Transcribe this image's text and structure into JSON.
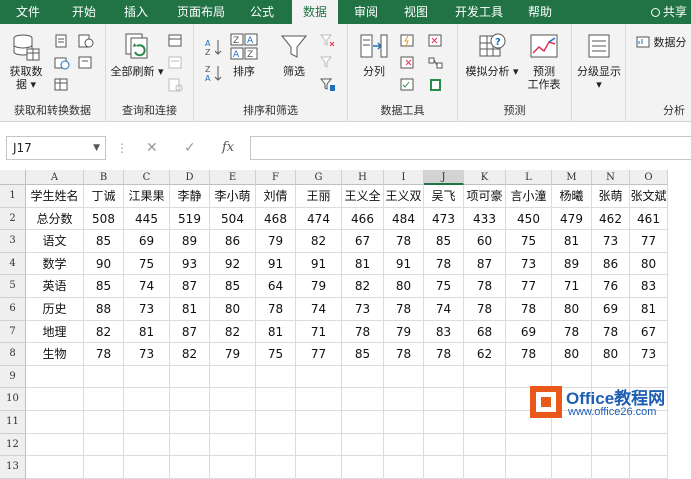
{
  "tabs": [
    "文件",
    "开始",
    "插入",
    "页面布局",
    "公式",
    "数据",
    "审阅",
    "视图",
    "开发工具",
    "帮助"
  ],
  "active_tab": "数据",
  "share_label": "共享",
  "ribbon": {
    "groups": [
      {
        "label": "获取和转换数据",
        "buttons": [
          "获取数据"
        ]
      },
      {
        "label": "查询和连接",
        "buttons": [
          "全部刷新"
        ]
      },
      {
        "label": "排序和筛选",
        "buttons": [
          "排序",
          "筛选"
        ]
      },
      {
        "label": "数据工具",
        "buttons": [
          "分列"
        ]
      },
      {
        "label": "预测",
        "buttons": [
          "模拟分析",
          "预测工作表"
        ]
      },
      {
        "label": "",
        "buttons": [
          "分级显示"
        ]
      },
      {
        "label": "分析",
        "buttons": [
          "数据分"
        ]
      }
    ],
    "get_data_line1": "获取数",
    "get_data_line2": "据",
    "refresh_all": "全部刷新",
    "sort": "排序",
    "filter": "筛选",
    "text_to_columns": "分列",
    "what_if": "模拟分析",
    "forecast_line1": "预测",
    "forecast_line2": "工作表",
    "outline": "分级显示",
    "data_analysis": "数据分"
  },
  "formula_bar": {
    "name_box": "J17",
    "fx": "fx",
    "cancel": "✕",
    "enter": "✓",
    "more": "⋮"
  },
  "columns": [
    "A",
    "B",
    "C",
    "D",
    "E",
    "F",
    "G",
    "H",
    "I",
    "J",
    "K",
    "L",
    "M",
    "N",
    "O"
  ],
  "selected_column": "J",
  "rows": [
    [
      "学生姓名",
      "丁诚",
      "江果果",
      "李静",
      "李小萌",
      "刘倩",
      "王丽",
      "王义全",
      "王义双",
      "吴飞",
      "项可豪",
      "言小潼",
      "杨曦",
      "张萌",
      "张文斌"
    ],
    [
      "总分数",
      "508",
      "445",
      "519",
      "504",
      "468",
      "474",
      "466",
      "484",
      "473",
      "433",
      "450",
      "479",
      "462",
      "461"
    ],
    [
      "语文",
      "85",
      "69",
      "89",
      "86",
      "79",
      "82",
      "67",
      "78",
      "85",
      "60",
      "75",
      "81",
      "73",
      "77"
    ],
    [
      "数学",
      "90",
      "75",
      "93",
      "92",
      "91",
      "91",
      "81",
      "91",
      "78",
      "87",
      "73",
      "89",
      "86",
      "80"
    ],
    [
      "英语",
      "85",
      "74",
      "87",
      "85",
      "64",
      "79",
      "82",
      "80",
      "75",
      "78",
      "77",
      "71",
      "76",
      "83"
    ],
    [
      "历史",
      "88",
      "73",
      "81",
      "80",
      "78",
      "74",
      "73",
      "78",
      "74",
      "78",
      "78",
      "80",
      "69",
      "81"
    ],
    [
      "地理",
      "82",
      "81",
      "87",
      "82",
      "81",
      "71",
      "78",
      "79",
      "83",
      "68",
      "69",
      "78",
      "78",
      "67"
    ],
    [
      "生物",
      "78",
      "73",
      "82",
      "79",
      "75",
      "77",
      "85",
      "78",
      "78",
      "62",
      "78",
      "80",
      "80",
      "73"
    ],
    [],
    [],
    [],
    [],
    []
  ],
  "row_numbers": [
    "1",
    "2",
    "3",
    "4",
    "5",
    "6",
    "7",
    "8",
    "9",
    "10",
    "11",
    "12",
    "13"
  ],
  "watermark": {
    "title": "Office教程网",
    "url": "www.office26.com"
  }
}
